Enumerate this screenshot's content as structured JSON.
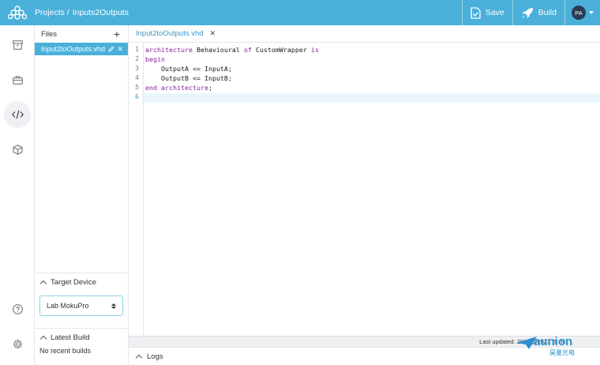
{
  "header": {
    "breadcrumb_root": "Projects /",
    "breadcrumb_project": "Inputs2Outputs",
    "save_label": "Save",
    "build_label": "Build",
    "avatar_initials": "PA"
  },
  "rail": {
    "icons": [
      "archive-icon",
      "briefcase-icon",
      "code-icon",
      "cube-icon",
      "help-icon",
      "settings-icon"
    ],
    "active": "code-icon"
  },
  "files_panel": {
    "title": "Files",
    "files": [
      {
        "name": "Input2toOutputs.vhd",
        "selected": true
      }
    ]
  },
  "target_device": {
    "title": "Target Device",
    "selected": "Lab MokuPro"
  },
  "latest_build": {
    "title": "Latest Build",
    "empty_text": "No recent builds"
  },
  "editor": {
    "tabs": [
      {
        "label": "Input2toOutputs.vhd"
      }
    ],
    "current_line": 6,
    "lines": [
      {
        "n": "1",
        "text": "architecture Behavioural of CustomWrapper is"
      },
      {
        "n": "2",
        "text": "begin"
      },
      {
        "n": "3",
        "text": "    OutputA <= InputA;"
      },
      {
        "n": "4",
        "text": "    OutputB <= InputB;"
      },
      {
        "n": "5",
        "text": "end architecture;"
      },
      {
        "n": "6",
        "text": ""
      }
    ]
  },
  "status_bar": {
    "text": "Last updated: 29/Sep/2021 (5 mi"
  },
  "logs_panel": {
    "title": "Logs"
  },
  "watermark": {
    "brand": "aunion",
    "sub": "昊量光电"
  },
  "colors": {
    "accent": "#4ab0d9",
    "keyword": "#8a1fa0",
    "avatar_bg": "#2a3b55"
  }
}
